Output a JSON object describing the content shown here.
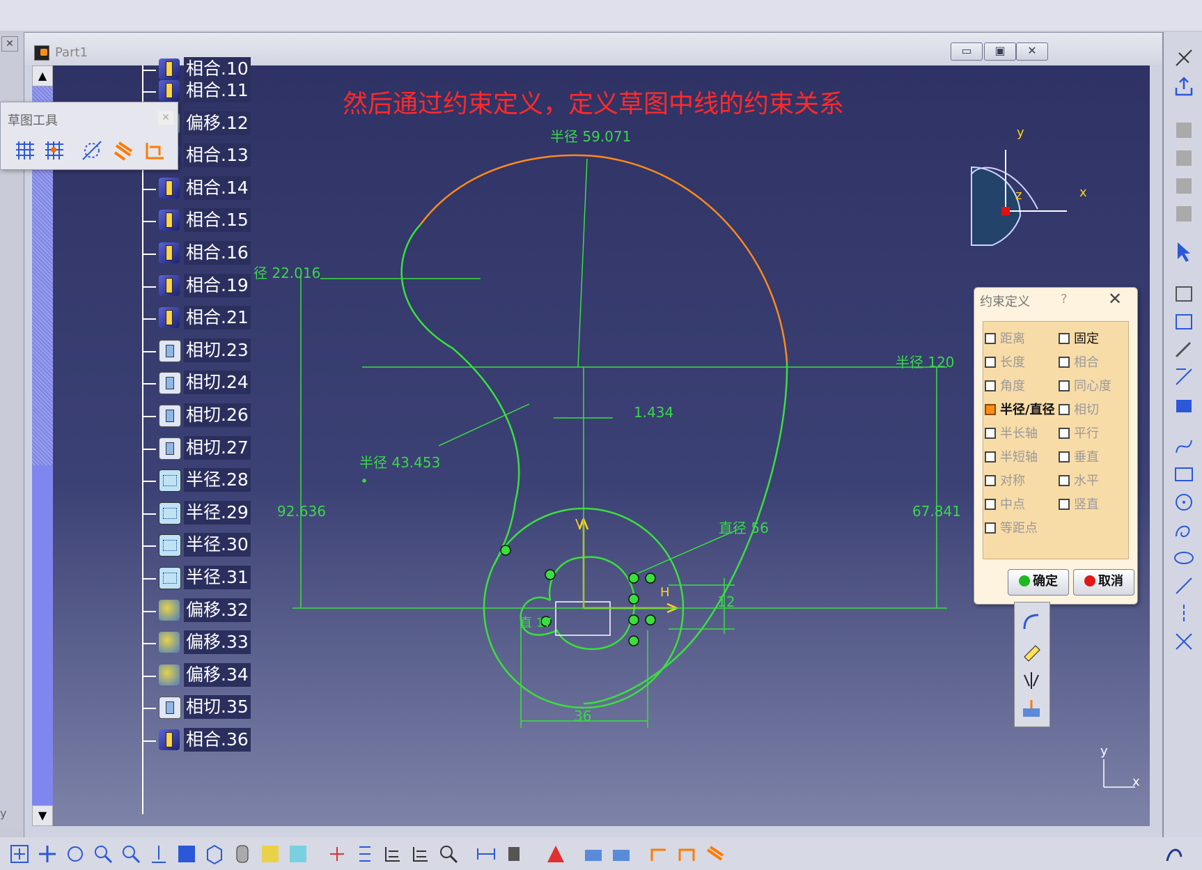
{
  "window": {
    "title": "Part1",
    "minimize_label": "▭",
    "restore_label": "▣",
    "close_label": "✕"
  },
  "left_panel": {
    "close_label": "✕",
    "axis_label": "y"
  },
  "annotation": "然后通过约束定义，定义草图中线的约束关系",
  "sketch_tools": {
    "title": "草图工具",
    "close_label": "✕",
    "tools": [
      {
        "icon": "grid-icon"
      },
      {
        "icon": "snap-to-point-icon"
      },
      {
        "icon": "construction-element-icon"
      },
      {
        "icon": "geometric-constraints-icon"
      },
      {
        "icon": "dimensional-constraints-icon"
      }
    ]
  },
  "tree": {
    "partial_top": "相合.10",
    "items": [
      {
        "label": "相合.11",
        "type": "coinc"
      },
      {
        "label": "偏移.12",
        "type": "off"
      },
      {
        "label": "相合.13",
        "type": "coinc"
      },
      {
        "label": "相合.14",
        "type": "coinc"
      },
      {
        "label": "相合.15",
        "type": "coinc"
      },
      {
        "label": "相合.16",
        "type": "coinc"
      },
      {
        "label": "相合.19",
        "type": "coinc"
      },
      {
        "label": "相合.21",
        "type": "coinc"
      },
      {
        "label": "相切.23",
        "type": "tan"
      },
      {
        "label": "相切.24",
        "type": "tan"
      },
      {
        "label": "相切.26",
        "type": "tan"
      },
      {
        "label": "相切.27",
        "type": "tan"
      },
      {
        "label": "半径.28",
        "type": "rad"
      },
      {
        "label": "半径.29",
        "type": "rad"
      },
      {
        "label": "半径.30",
        "type": "rad"
      },
      {
        "label": "半径.31",
        "type": "rad"
      },
      {
        "label": "偏移.32",
        "type": "off"
      },
      {
        "label": "偏移.33",
        "type": "off"
      },
      {
        "label": "偏移.34",
        "type": "off"
      },
      {
        "label": "相切.35",
        "type": "tan"
      },
      {
        "label": "相合.36",
        "type": "coinc"
      }
    ]
  },
  "dimensions": {
    "r59": "半径 59.071",
    "r22": "径 22.016",
    "r120": "半径 120",
    "d1434": "1.434",
    "r43": "半径 43.453",
    "d92": "92.636",
    "d67": "67.841",
    "dia56": "直径 56",
    "d12": "12",
    "d36": "36",
    "dia17": "直 17",
    "h_label": "H",
    "v_label": "V"
  },
  "compass": {
    "x": "x",
    "y": "y",
    "z": "z"
  },
  "corner_axes": {
    "x": "x",
    "y": "y"
  },
  "constraint_dialog": {
    "title": "约束定义",
    "help": "?",
    "close": "✕",
    "options_left": [
      {
        "label": "距离",
        "checked": false,
        "enabled": false
      },
      {
        "label": "长度",
        "checked": false,
        "enabled": false
      },
      {
        "label": "角度",
        "checked": false,
        "enabled": false
      },
      {
        "label": "半径/直径",
        "checked": true,
        "enabled": true
      },
      {
        "label": "半长轴",
        "checked": false,
        "enabled": false
      },
      {
        "label": "半短轴",
        "checked": false,
        "enabled": false
      },
      {
        "label": "对称",
        "checked": false,
        "enabled": false
      },
      {
        "label": "中点",
        "checked": false,
        "enabled": false
      },
      {
        "label": "等距点",
        "checked": false,
        "enabled": false
      }
    ],
    "options_right": [
      {
        "label": "固定",
        "checked": false,
        "enabled": true
      },
      {
        "label": "相合",
        "checked": false,
        "enabled": false
      },
      {
        "label": "同心度",
        "checked": false,
        "enabled": false
      },
      {
        "label": "相切",
        "checked": false,
        "enabled": false
      },
      {
        "label": "平行",
        "checked": false,
        "enabled": false
      },
      {
        "label": "垂直",
        "checked": false,
        "enabled": false
      },
      {
        "label": "水平",
        "checked": false,
        "enabled": false
      },
      {
        "label": "竖直",
        "checked": false,
        "enabled": false
      }
    ],
    "ok": "确定",
    "cancel": "取消"
  },
  "colors": {
    "sketch_green": "#39e03c",
    "arc_orange": "#ff8a1c",
    "annotation_red": "#ff2a2a",
    "axis_yellow": "#ffd21c"
  }
}
